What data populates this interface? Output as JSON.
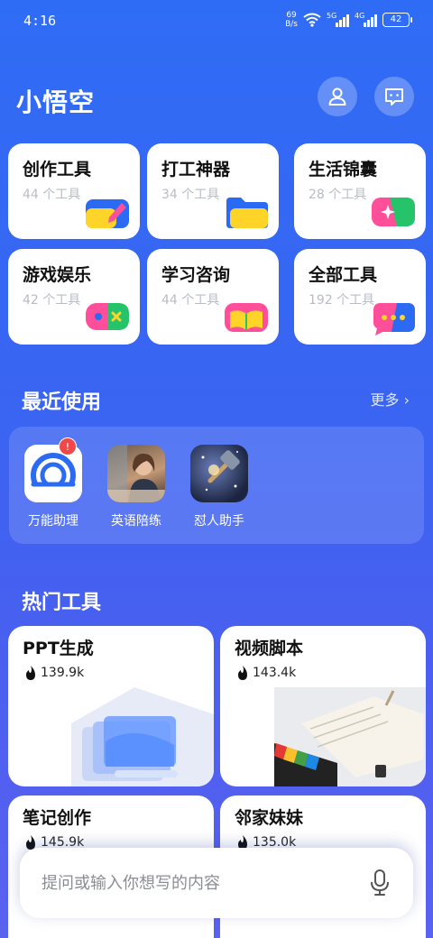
{
  "status": {
    "time": "4:16",
    "net_speed_value": "69",
    "net_speed_unit": "B/s",
    "signal_1": "5G",
    "signal_2": "4G",
    "battery": "42"
  },
  "header": {
    "title": "小悟空",
    "profile_icon": "person-icon",
    "message_icon": "chat-icon"
  },
  "categories": [
    {
      "name": "创作工具",
      "count": "44 个工具"
    },
    {
      "name": "打工神器",
      "count": "34 个工具"
    },
    {
      "name": "生活锦囊",
      "count": "28 个工具"
    },
    {
      "name": "游戏娱乐",
      "count": "42 个工具"
    },
    {
      "name": "学习咨询",
      "count": "44 个工具"
    },
    {
      "name": "全部工具",
      "count": "192 个工具"
    }
  ],
  "recent": {
    "title": "最近使用",
    "more": "更多 ›",
    "items": [
      {
        "label": "万能助理",
        "badge": "!"
      },
      {
        "label": "英语陪练"
      },
      {
        "label": "怼人助手"
      }
    ]
  },
  "hot": {
    "title": "热门工具",
    "items": [
      {
        "name": "PPT生成",
        "count": "139.9k"
      },
      {
        "name": "视频脚本",
        "count": "143.4k"
      },
      {
        "name": "笔记创作",
        "count": "145.9k"
      },
      {
        "name": "邻家妹妹",
        "count": "135.0k"
      }
    ]
  },
  "input": {
    "placeholder": "提问或输入你想写的内容"
  },
  "colors": {
    "accent": "#3a64f2",
    "yellow": "#ffd428",
    "pink": "#ff4f9a",
    "green": "#25c46a",
    "blue": "#2b6bf3"
  }
}
